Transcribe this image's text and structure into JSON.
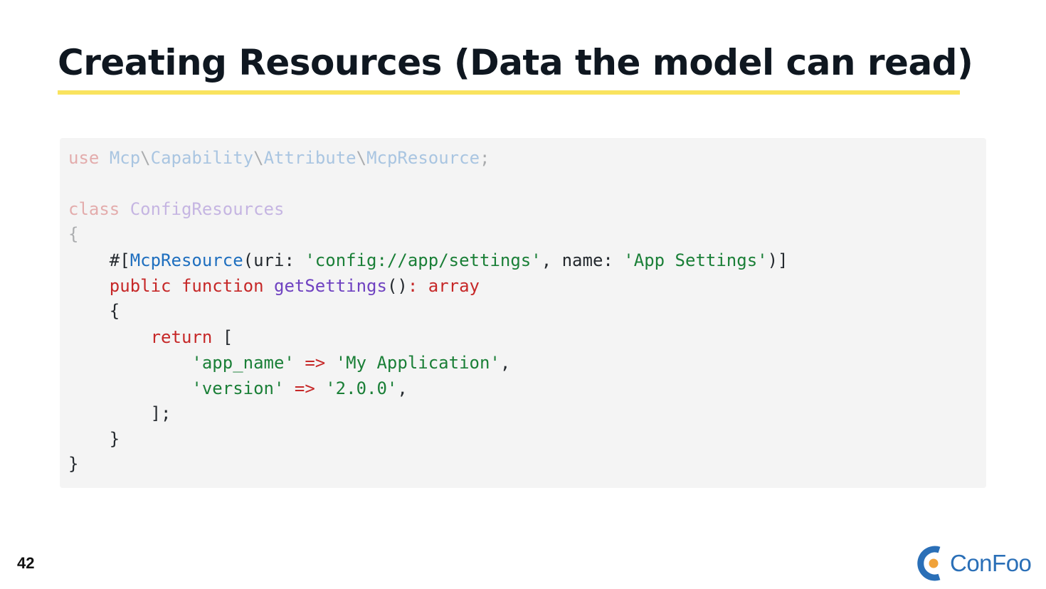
{
  "slide": {
    "title": "Creating Resources (Data the model can read)",
    "page_number": "42"
  },
  "code": {
    "l1": {
      "a": "use",
      "b": "Mcp",
      "c": "\\",
      "d": "Capability",
      "e": "\\",
      "f": "Attribute",
      "g": "\\",
      "h": "McpResource",
      "i": ";"
    },
    "l3": {
      "a": "class",
      "b": "ConfigResources"
    },
    "l4": "{",
    "l5": {
      "a": "    #[",
      "b": "McpResource",
      "c": "(uri: ",
      "d": "'config://app/settings'",
      "e": ", name: ",
      "f": "'App Settings'",
      "g": ")]"
    },
    "l6": {
      "a": "    ",
      "b": "public",
      "c": "function",
      "d": "getSettings",
      "e": "()",
      "f": ": array"
    },
    "l7": "    {",
    "l8": {
      "a": "        ",
      "b": "return",
      "c": " ["
    },
    "l9": {
      "a": "            ",
      "b": "'app_name'",
      "c": " => ",
      "d": "'My Application'",
      "e": ","
    },
    "l10": {
      "a": "            ",
      "b": "'version'",
      "c": " => ",
      "d": "'2.0.0'",
      "e": ","
    },
    "l11": "        ];",
    "l12": "    }",
    "l13": "}"
  },
  "branding": {
    "logo_text": "ConFoo",
    "logo_blue": "#2a6fb7",
    "logo_orange": "#f0a23a"
  },
  "colors": {
    "title_underline": "#f9e35f",
    "code_background": "#f4f4f4"
  }
}
